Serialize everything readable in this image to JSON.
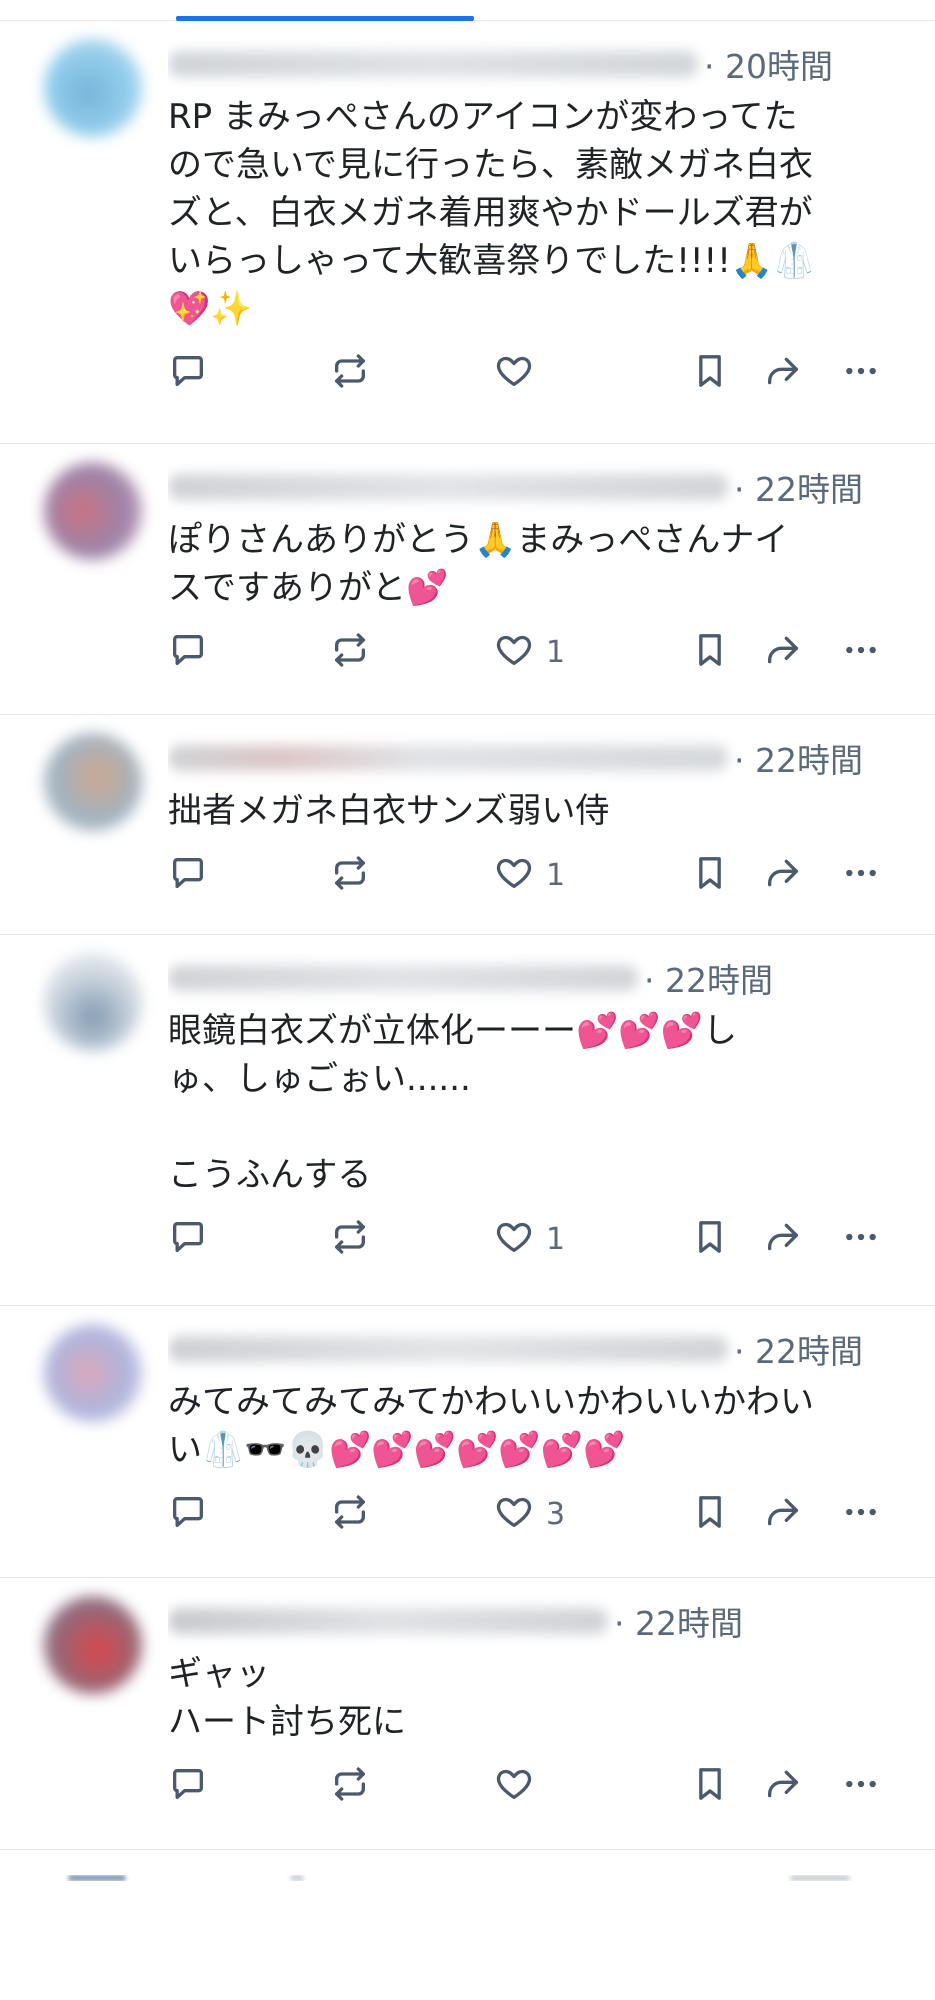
{
  "posts": [
    {
      "time": "20時間",
      "lines": [
        "RP まみっぺさんのアイコンが変わってた",
        "ので急いで見に行ったら、素敵メガネ白衣",
        "ズと、白衣メガネ着用爽やかドールズ君が",
        "いらっしゃって大歓喜祭りでした!!!!🙏🥼",
        "💖✨"
      ],
      "likes": ""
    },
    {
      "time": "22時間",
      "lines": [
        "ぽりさんありがとう🙏まみっぺさんナイ",
        "スですありがと💕"
      ],
      "likes": "1"
    },
    {
      "time": "22時間",
      "lines": [
        "拙者メガネ白衣サンズ弱い侍"
      ],
      "likes": "1"
    },
    {
      "time": "22時間",
      "lines": [
        "眼鏡白衣ズが立体化ーーー💕💕💕し",
        "ゅ、しゅごぉい......",
        "",
        "こうふんする"
      ],
      "likes": "1"
    },
    {
      "time": "22時間",
      "lines": [
        "みてみてみてみてかわいいかわいいかわい",
        "い🥼🕶️💀💕💕💕💕💕💕💕"
      ],
      "likes": "3"
    },
    {
      "time": "22時間",
      "lines": [
        "ギャッ",
        "ハート討ち死に"
      ],
      "likes": ""
    }
  ],
  "icons": {
    "reply": "reply-icon",
    "repost": "repost-icon",
    "like": "heart-icon",
    "save": "bookmark-icon",
    "share": "share-icon",
    "more": "more-icon"
  },
  "colors": {
    "accent": "#1a73e8",
    "meta_text": "#5b6a7b",
    "icon": "#4a5a6c",
    "divider": "#e3e6ea"
  }
}
